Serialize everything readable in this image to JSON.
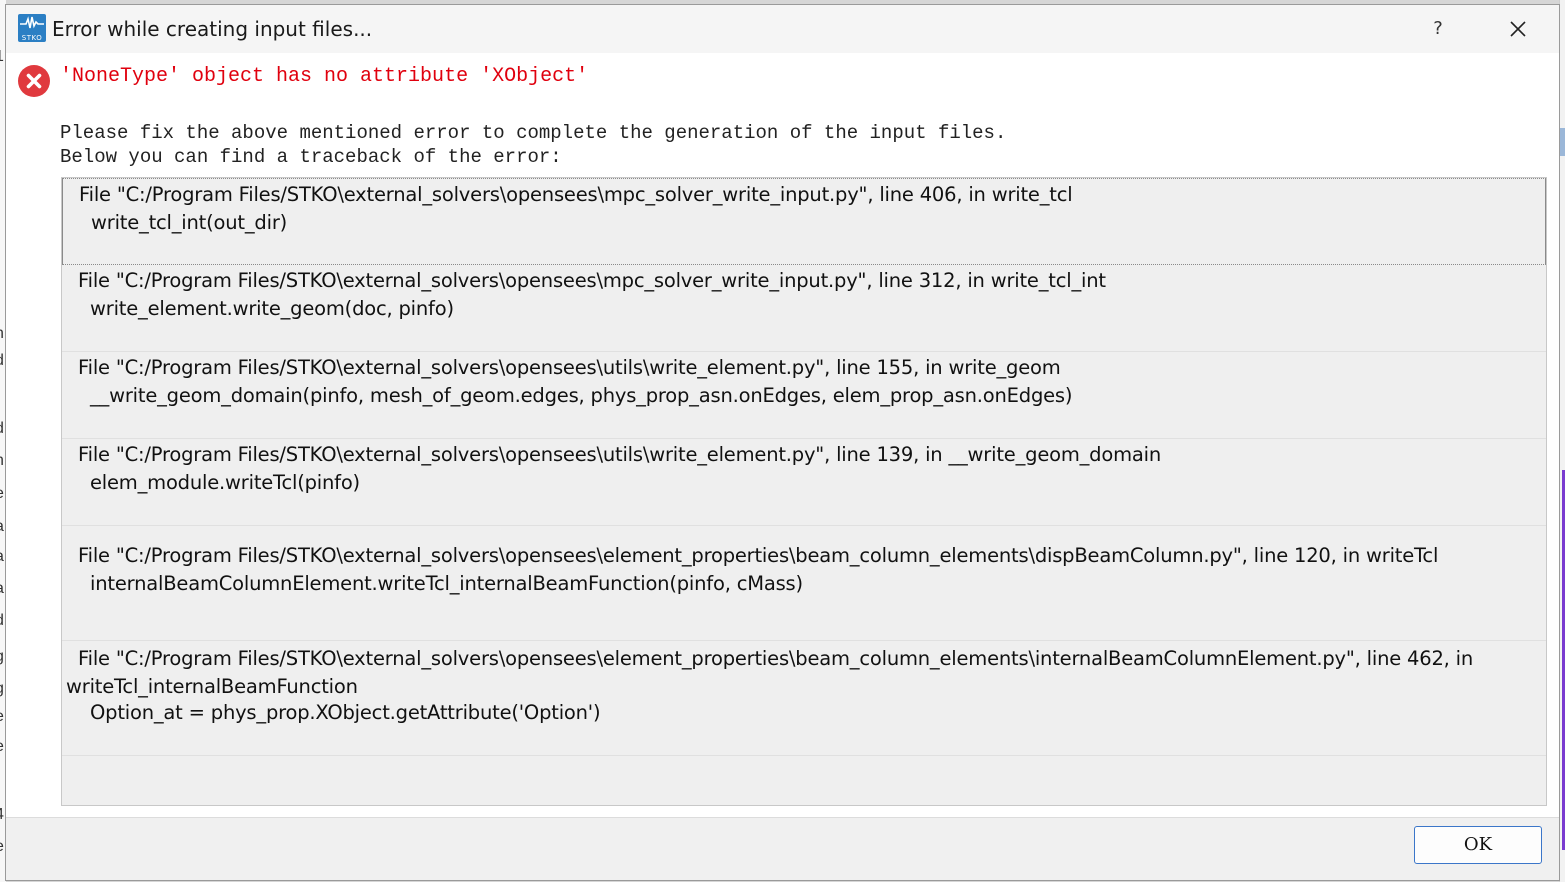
{
  "window": {
    "title": "Error while creating input files...",
    "help_label": "?",
    "app_icon_text": "STKO"
  },
  "error": {
    "message": "'NoneType' object has no attribute 'XObject'"
  },
  "info": {
    "line1": "Please fix the above mentioned error to complete the generation of the input files.",
    "line2": "Below you can find a traceback of the error:"
  },
  "traceback": [
    {
      "file_line": "File \"C:/Program Files/STKO\\external_solvers\\opensees\\mpc_solver_write_input.py\", line 406, in write_tcl",
      "code_line": "write_tcl_int(out_dir)"
    },
    {
      "file_line": "File \"C:/Program Files/STKO\\external_solvers\\opensees\\mpc_solver_write_input.py\", line 312, in write_tcl_int",
      "code_line": "write_element.write_geom(doc, pinfo)"
    },
    {
      "file_line": "File \"C:/Program Files/STKO\\external_solvers\\opensees\\utils\\write_element.py\", line 155, in write_geom",
      "code_line": "__write_geom_domain(pinfo, mesh_of_geom.edges,  phys_prop_asn.onEdges, elem_prop_asn.onEdges)"
    },
    {
      "file_line": "File \"C:/Program Files/STKO\\external_solvers\\opensees\\utils\\write_element.py\", line 139, in __write_geom_domain",
      "code_line": "elem_module.writeTcl(pinfo)"
    },
    {
      "file_line": "File \"C:/Program Files/STKO\\external_solvers\\opensees\\element_properties\\beam_column_elements\\dispBeamColumn.py\", line 120, in writeTcl",
      "code_line": "internalBeamColumnElement.writeTcl_internalBeamFunction(pinfo, cMass)"
    },
    {
      "file_line": "File \"C:/Program Files/STKO\\external_solvers\\opensees\\element_properties\\beam_column_elements\\internalBeamColumnElement.py\", line 462, in writeTcl_internalBeamFunction",
      "code_line": "Option_at = phys_prop.XObject.getAttribute('Option')"
    }
  ],
  "buttons": {
    "ok_label": "OK"
  },
  "background": {
    "left_chars": [
      "1",
      "n",
      "d",
      "t",
      "d",
      "n",
      "e",
      "a",
      "a",
      "a",
      "d",
      "g",
      "g",
      "e",
      "e.",
      "4",
      "e"
    ]
  },
  "colors": {
    "error_text": "#e0000e",
    "error_icon": "#e0393e",
    "ok_border": "#3b76c9"
  }
}
